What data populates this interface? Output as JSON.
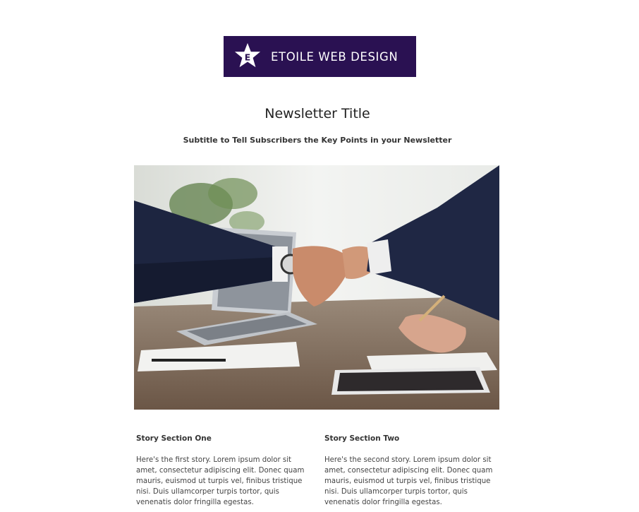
{
  "logo": {
    "text": "ETOILE WEB DESIGN",
    "emblem_letter": "E",
    "background_color": "#2a1152",
    "icon": "star-icon"
  },
  "newsletter": {
    "title": "Newsletter Title",
    "subtitle": "Subtitle to Tell Subscribers the Key Points in your Newsletter"
  },
  "hero_image": {
    "icon": "handshake-photo"
  },
  "stories": [
    {
      "heading": "Story Section One",
      "body": "Here's the first story. Lorem ipsum dolor sit amet, consectetur adipiscing elit. Donec quam mauris, euismod ut turpis vel, finibus tristique nisi. Duis ullamcorper turpis tortor, quis venenatis dolor fringilla egestas."
    },
    {
      "heading": "Story Section Two",
      "body": "Here's the second story. Lorem ipsum dolor sit amet, consectetur adipiscing elit. Donec quam mauris, euismod ut turpis vel, finibus tristique nisi. Duis ullamcorper turpis tortor, quis venenatis dolor fringilla egestas."
    }
  ]
}
